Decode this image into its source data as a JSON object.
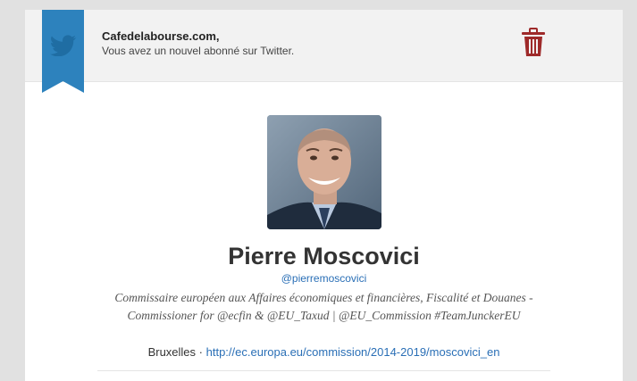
{
  "notification": {
    "site_name": "Cafedelabourse.com,",
    "message": "Vous avez un nouvel abonné sur Twitter."
  },
  "profile": {
    "name": "Pierre Moscovici",
    "handle": "@pierremoscovici",
    "bio": "Commissaire européen aux Affaires économiques et financières, Fiscalité et Douanes - Commissioner for @ecfin & @EU_Taxud | @EU_Commission #TeamJunckerEU",
    "location": "Bruxelles",
    "separator": "·",
    "website": "http://ec.europa.eu/commission/2014-2019/moscovici_en"
  },
  "icons": {
    "ribbon": "twitter-bird-icon",
    "delete": "trash-icon"
  },
  "colors": {
    "ribbon": "#2d82bd",
    "link": "#2a6fb6",
    "trash": "#9e2a2a"
  }
}
